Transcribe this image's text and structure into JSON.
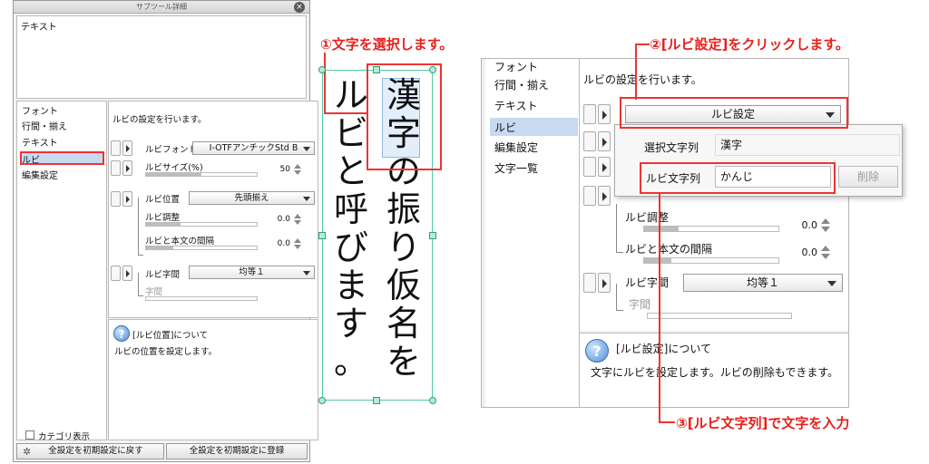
{
  "left_panel": {
    "title": "サブツール詳細",
    "preview_label": "テキスト",
    "categories": [
      "フォント",
      "行間・揃え",
      "テキスト",
      "ルビ",
      "編集設定"
    ],
    "settings": {
      "intro": "ルビの設定を行います。",
      "ruby_font_label": "ルビフォント",
      "ruby_font_value": "I-OTFアンチックStd B",
      "ruby_size_label": "ルビサイズ(%)",
      "ruby_size_value": "50",
      "ruby_size_fill": 0.5,
      "ruby_position_label": "ルビ位置",
      "ruby_position_value": "先頭揃え",
      "ruby_adjust_label": "ルビ調整",
      "ruby_adjust_value": "0.0",
      "ruby_spacing_label": "ルビと本文の間隔",
      "ruby_spacing_value": "0.0",
      "ruby_char_spacing_label": "ルビ字間",
      "ruby_char_spacing_value": "均等１",
      "char_spacing_label": "字間"
    },
    "help": {
      "title": "[ルビ位置]について",
      "body": "ルビの位置を設定します。"
    },
    "category_display_label": "カテゴリ表示",
    "reset_button": "全設定を初期設定に戻す",
    "register_button": "全設定を初期設定に登録"
  },
  "middle": {
    "step1": "①文字を選択します。",
    "column_right": [
      "漢",
      "字",
      "の",
      "振",
      "り",
      "仮",
      "名",
      "を"
    ],
    "column_left": [
      "ル",
      "ビ",
      "と",
      "呼",
      "び",
      "ま",
      "す",
      "。"
    ]
  },
  "right_panel": {
    "categories": [
      "フォント",
      "行間・揃え",
      "テキスト",
      "ルビ",
      "編集設定",
      "文字一覧"
    ],
    "intro": "ルビの設定を行います。",
    "ruby_setting_button": "ルビ設定",
    "popup": {
      "selected_label": "選択文字列",
      "selected_value": "漢字",
      "ruby_label": "ルビ文字列",
      "ruby_value": "かんじ",
      "delete_button": "削除"
    },
    "ruby_adjust_label": "ルビ調整",
    "ruby_adjust_value": "0.0",
    "ruby_spacing_label": "ルビと本文の間隔",
    "ruby_spacing_value": "0.0",
    "ruby_char_spacing_label": "ルビ字間",
    "ruby_char_spacing_value": "均等１",
    "char_spacing_label": "字間",
    "help": {
      "title": "[ルビ設定]について",
      "body": "文字にルビを設定します。ルビの削除もできます。"
    }
  },
  "callouts": {
    "step2": "②[ルビ設定]をクリックします。",
    "step3": "③[ルビ文字列]で文字を入力"
  },
  "colors": {
    "accent_red": "#e6201b",
    "selection_blue": "#c7daf2",
    "frame_green": "#4fc9a4"
  }
}
